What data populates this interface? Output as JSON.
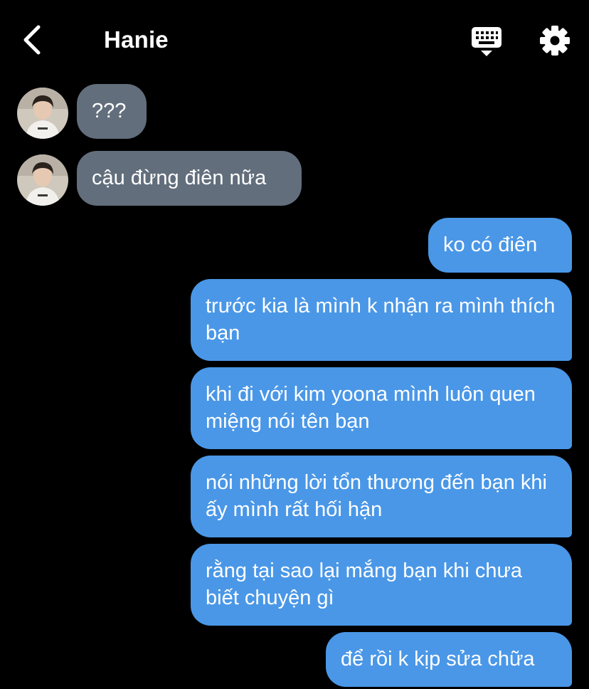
{
  "header": {
    "title": "Hanie",
    "back_icon": "chevron-left-icon",
    "keyboard_icon": "keyboard-icon",
    "settings_icon": "gear-icon"
  },
  "colors": {
    "background": "#000000",
    "incoming_bubble": "#626e7c",
    "outgoing_bubble": "#4a97e7",
    "text": "#ffffff"
  },
  "messages": [
    {
      "direction": "incoming",
      "text": "???"
    },
    {
      "direction": "incoming",
      "text": "cậu đừng điên nữa"
    },
    {
      "direction": "outgoing",
      "text": "ko có điên"
    },
    {
      "direction": "outgoing",
      "text": "trước kia là mình k nhận ra mình thích bạn"
    },
    {
      "direction": "outgoing",
      "text": "khi đi với kim yoona mình luôn quen miệng nói tên bạn"
    },
    {
      "direction": "outgoing",
      "text": "nói những lời tổn thương đến bạn khi ấy mình rất hối hận"
    },
    {
      "direction": "outgoing",
      "text": "rằng tại sao lại mắng bạn khi chưa biết chuyện gì"
    },
    {
      "direction": "outgoing",
      "text": "để rồi k kịp sửa chữa"
    }
  ]
}
